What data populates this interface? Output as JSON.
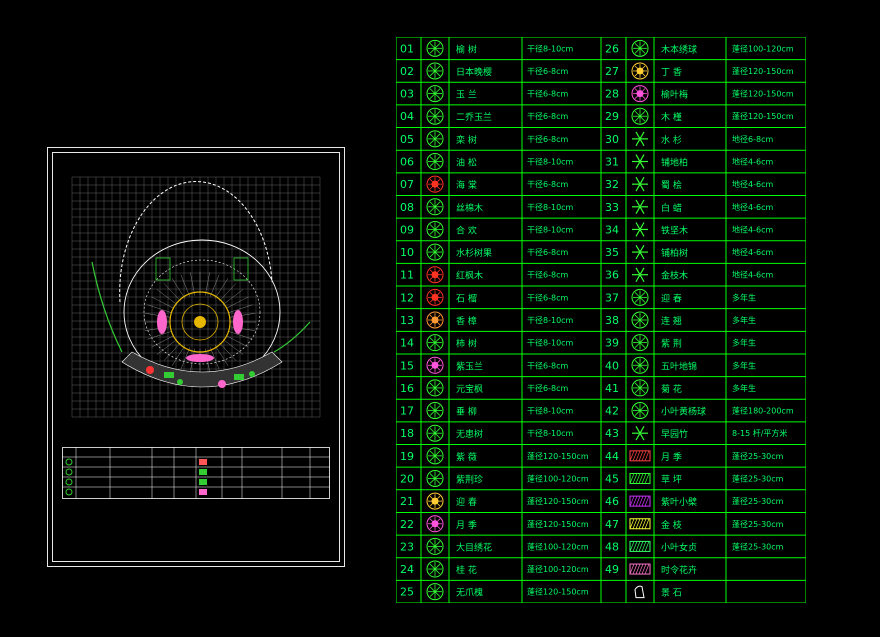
{
  "colors": {
    "background": "#000000",
    "line": "#00ff00",
    "text": "#00ff66",
    "frame": "#e8e8e8",
    "grid": "#8a8a8a"
  },
  "legend": {
    "left_rows": [
      {
        "no": "01",
        "name": "榆 树",
        "spec": "干径8-10cm",
        "icon": "tree-circle-icon"
      },
      {
        "no": "02",
        "name": "日本晚樱",
        "spec": "干径6-8cm",
        "icon": "tree-circle-icon"
      },
      {
        "no": "03",
        "name": "玉 兰",
        "spec": "干径6-8cm",
        "icon": "tree-circle-icon"
      },
      {
        "no": "04",
        "name": "二乔玉兰",
        "spec": "干径6-8cm",
        "icon": "tree-star-icon"
      },
      {
        "no": "05",
        "name": "栾 树",
        "spec": "干径6-8cm",
        "icon": "tree-star-icon"
      },
      {
        "no": "06",
        "name": "油 松",
        "spec": "干径8-10cm",
        "icon": "tree-circle-icon"
      },
      {
        "no": "07",
        "name": "海 棠",
        "spec": "干径6-8cm",
        "icon": "tree-red-icon"
      },
      {
        "no": "08",
        "name": "丝棉木",
        "spec": "干径8-10cm",
        "icon": "tree-star-icon"
      },
      {
        "no": "09",
        "name": "合 欢",
        "spec": "干径8-10cm",
        "icon": "tree-star-icon"
      },
      {
        "no": "10",
        "name": "水杉树果",
        "spec": "干径6-8cm",
        "icon": "tree-outline-icon"
      },
      {
        "no": "11",
        "name": "红枫木",
        "spec": "干径6-8cm",
        "icon": "tree-red-icon"
      },
      {
        "no": "12",
        "name": "石 榴",
        "spec": "干径6-8cm",
        "icon": "tree-red-icon"
      },
      {
        "no": "13",
        "name": "香 樟",
        "spec": "干径8-10cm",
        "icon": "tree-orange-icon"
      },
      {
        "no": "14",
        "name": "柿 树",
        "spec": "干径8-10cm",
        "icon": "tree-circle-icon"
      },
      {
        "no": "15",
        "name": "紫玉兰",
        "spec": "干径6-8cm",
        "icon": "tree-magenta-icon"
      },
      {
        "no": "16",
        "name": "元宝枫",
        "spec": "干径6-8cm",
        "icon": "tree-circle-icon"
      },
      {
        "no": "17",
        "name": "垂 柳",
        "spec": "干径8-10cm",
        "icon": "tree-cloud-icon"
      },
      {
        "no": "18",
        "name": "无患树",
        "spec": "干径8-10cm",
        "icon": "tree-outline-icon"
      },
      {
        "no": "19",
        "name": "紫 薇",
        "spec": "蓬径120-150cm",
        "icon": "shrub-icon"
      },
      {
        "no": "20",
        "name": "紫荆珍",
        "spec": "蓬径100-120cm",
        "icon": "shrub-icon"
      },
      {
        "no": "21",
        "name": "迎 春",
        "spec": "蓬径120-150cm",
        "icon": "shrub-orange-icon"
      },
      {
        "no": "22",
        "name": "月 季",
        "spec": "蓬径120-150cm",
        "icon": "shrub-magenta-icon"
      },
      {
        "no": "23",
        "name": "大目绣花",
        "spec": "蓬径100-120cm",
        "icon": "shrub-icon"
      },
      {
        "no": "24",
        "name": "桂 花",
        "spec": "蓬径100-120cm",
        "icon": "shrub-ring-icon"
      },
      {
        "no": "25",
        "name": "无爪槐",
        "spec": "蓬径120-150cm",
        "icon": "shrub-icon"
      }
    ],
    "right_rows": [
      {
        "no": "26",
        "name": "木本绣球",
        "spec": "蓬径100-120cm",
        "icon": "shrub-icon"
      },
      {
        "no": "27",
        "name": "丁 香",
        "spec": "蓬径120-150cm",
        "icon": "shrub-orange-icon"
      },
      {
        "no": "28",
        "name": "榆叶梅",
        "spec": "蓬径120-150cm",
        "icon": "shrub-magenta-icon"
      },
      {
        "no": "29",
        "name": "木 槿",
        "spec": "蓬径120-150cm",
        "icon": "shrub-star-icon"
      },
      {
        "no": "30",
        "name": "水 杉",
        "spec": "地径6-8cm",
        "icon": "conifer-icon"
      },
      {
        "no": "31",
        "name": "铺地柏",
        "spec": "地径4-6cm",
        "icon": "conifer-icon"
      },
      {
        "no": "32",
        "name": "蜀 桧",
        "spec": "地径4-6cm",
        "icon": "conifer-icon"
      },
      {
        "no": "33",
        "name": "白 蜡",
        "spec": "地径4-6cm",
        "icon": "conifer-icon"
      },
      {
        "no": "34",
        "name": "铁坚木",
        "spec": "地径4-6cm",
        "icon": "conifer-icon"
      },
      {
        "no": "35",
        "name": "铺柏树",
        "spec": "地径4-6cm",
        "icon": "conifer-icon"
      },
      {
        "no": "36",
        "name": "金枝木",
        "spec": "地径4-6cm",
        "icon": "conifer-icon"
      },
      {
        "no": "37",
        "name": "迎 春",
        "spec": "多年生",
        "icon": "shrub-icon"
      },
      {
        "no": "38",
        "name": "连 翘",
        "spec": "多年生",
        "icon": "shrub-icon"
      },
      {
        "no": "39",
        "name": "紫 荆",
        "spec": "多年生",
        "icon": "shrub-icon"
      },
      {
        "no": "40",
        "name": "五叶地锦",
        "spec": "多年生",
        "icon": "vine-icon"
      },
      {
        "no": "41",
        "name": "菊 花",
        "spec": "多年生",
        "icon": "flower-icon"
      },
      {
        "no": "42",
        "name": "小叶黄杨球",
        "spec": "蓬径180-200cm",
        "icon": "vine-icon"
      },
      {
        "no": "43",
        "name": "早园竹",
        "spec": "8-15 杆/平方米",
        "icon": "bamboo-icon"
      },
      {
        "no": "44",
        "name": "月 季",
        "spec": "蓬径25-30cm",
        "icon": "hatch-red-icon"
      },
      {
        "no": "45",
        "name": "草 坪",
        "spec": "蓬径25-30cm",
        "icon": "hatch-green-icon"
      },
      {
        "no": "46",
        "name": "紫叶小檗",
        "spec": "蓬径25-30cm",
        "icon": "hatch-magenta-icon"
      },
      {
        "no": "47",
        "name": "金 枝",
        "spec": "蓬径25-30cm",
        "icon": "hatch-yellow-icon"
      },
      {
        "no": "48",
        "name": "小叶女贞",
        "spec": "蓬径25-30cm",
        "icon": "hatch-green2-icon"
      },
      {
        "no": "49",
        "name": "时令花卉",
        "spec": "",
        "icon": "hatch-pink-icon"
      },
      {
        "no": "",
        "name": "景 石",
        "spec": "",
        "icon": "rock-icon"
      }
    ]
  }
}
